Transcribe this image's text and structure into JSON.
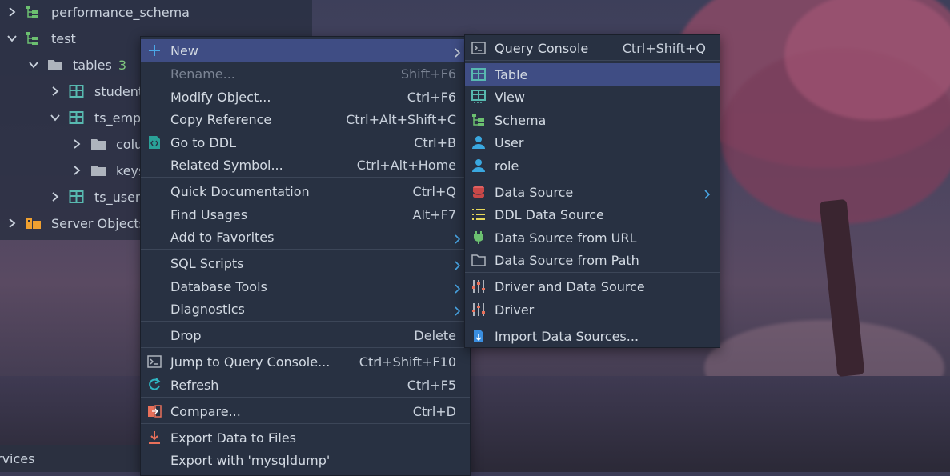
{
  "tree": {
    "items": [
      {
        "label": "performance_schema"
      },
      {
        "label": "test"
      },
      {
        "label": "tables",
        "count": "3"
      },
      {
        "label": "student"
      },
      {
        "label": "ts_emp"
      },
      {
        "label": "colu"
      },
      {
        "label": "keys"
      },
      {
        "label": "ts_user"
      },
      {
        "label": "Server Objects"
      }
    ],
    "services_label": "rvices"
  },
  "context_menu": {
    "items": [
      {
        "label": "New",
        "shortcut": "",
        "submenu": true,
        "icon": "plus-icon"
      },
      {
        "label": "Rename...",
        "shortcut": "Shift+F6",
        "disabled": true
      },
      {
        "label": "Modify Object...",
        "shortcut": "Ctrl+F6"
      },
      {
        "label": "Copy Reference",
        "shortcut": "Ctrl+Alt+Shift+C"
      },
      {
        "label": "Go to DDL",
        "shortcut": "Ctrl+B",
        "icon": "ddl-icon"
      },
      {
        "label": "Related Symbol...",
        "shortcut": "Ctrl+Alt+Home"
      },
      {
        "label": "Quick Documentation",
        "shortcut": "Ctrl+Q"
      },
      {
        "label": "Find Usages",
        "shortcut": "Alt+F7"
      },
      {
        "label": "Add to Favorites",
        "shortcut": "",
        "submenu": true
      },
      {
        "label": "SQL Scripts",
        "shortcut": "",
        "submenu": true
      },
      {
        "label": "Database Tools",
        "shortcut": "",
        "submenu": true
      },
      {
        "label": "Diagnostics",
        "shortcut": "",
        "submenu": true
      },
      {
        "label": "Drop",
        "shortcut": "Delete"
      },
      {
        "label": "Jump to Query Console...",
        "shortcut": "Ctrl+Shift+F10",
        "icon": "console-icon"
      },
      {
        "label": "Refresh",
        "shortcut": "Ctrl+F5",
        "icon": "refresh-icon"
      },
      {
        "label": "Compare...",
        "shortcut": "Ctrl+D",
        "icon": "compare-icon"
      },
      {
        "label": "Export Data to Files",
        "shortcut": "",
        "icon": "export-icon"
      },
      {
        "label": "Export with 'mysqldump'",
        "shortcut": ""
      }
    ]
  },
  "new_submenu": {
    "items": [
      {
        "label": "Query Console",
        "shortcut": "Ctrl+Shift+Q",
        "icon": "console-icon"
      },
      {
        "label": "Table",
        "shortcut": "",
        "icon": "table-icon",
        "active": true
      },
      {
        "label": "View",
        "shortcut": "",
        "icon": "view-icon"
      },
      {
        "label": "Schema",
        "shortcut": "",
        "icon": "schema-icon"
      },
      {
        "label": "User",
        "shortcut": "",
        "icon": "user-icon"
      },
      {
        "label": "role",
        "shortcut": "",
        "icon": "user-icon"
      },
      {
        "label": "Data Source",
        "shortcut": "",
        "icon": "database-icon",
        "submenu": true
      },
      {
        "label": "DDL Data Source",
        "shortcut": "",
        "icon": "ddl-list-icon"
      },
      {
        "label": "Data Source from URL",
        "shortcut": "",
        "icon": "plug-icon"
      },
      {
        "label": "Data Source from Path",
        "shortcut": "",
        "icon": "folder-icon"
      },
      {
        "label": "Driver and Data Source",
        "shortcut": "",
        "icon": "driver-icon"
      },
      {
        "label": "Driver",
        "shortcut": "",
        "icon": "driver-icon"
      },
      {
        "label": "Import Data Sources...",
        "shortcut": "",
        "icon": "import-icon"
      }
    ]
  },
  "colors": {
    "menu_bg": "#283142",
    "active_bg": "#3f4d84",
    "schema_green": "#6cc070",
    "table_teal": "#58b9b0"
  }
}
